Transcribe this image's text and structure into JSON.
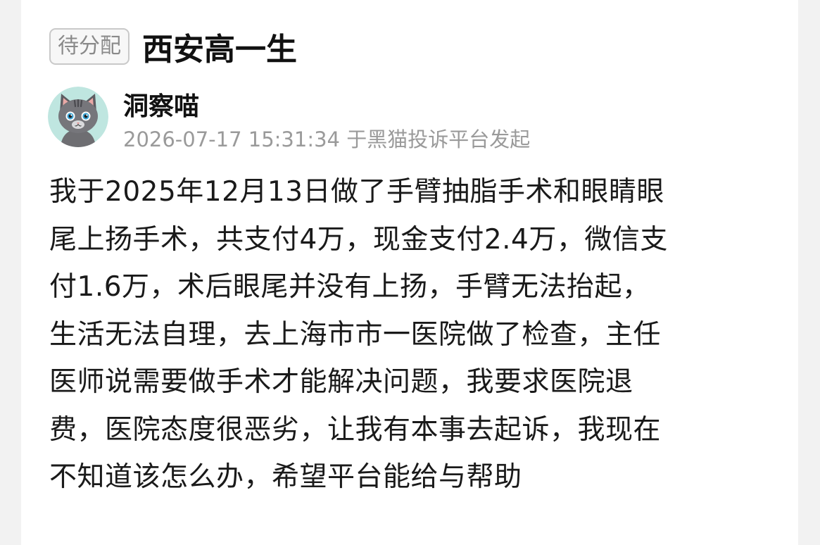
{
  "header": {
    "status_badge": "待分配",
    "title": "西安高一生"
  },
  "author": {
    "name": "洞察喵",
    "avatar_icon": "cat-avatar-icon",
    "meta": "2026-07-17 15:31:34 于黑猫投诉平台发起"
  },
  "post": {
    "lines": [
      "我于2025年12月13日做了手臂抽脂手术和眼睛眼",
      "尾上扬手术，共支付4万，现金支付2.4万，微信支",
      "付1.6万，术后眼尾并没有上扬，手臂无法抬起，",
      "生活无法自理，去上海市市一医院做了检查，主任",
      "医师说需要做手术才能解决问题，我要求医院退",
      "费，医院态度很恶劣，让我有本事去起诉，我现在",
      "不知道该怎么办，希望平台能给与帮助"
    ]
  },
  "colors": {
    "background": "#f2f2f2",
    "card": "#ffffff",
    "badge_border": "#c9c9c9",
    "badge_text": "#8a8a8a",
    "meta_text": "#9a9a9a",
    "body_text": "#1a1a1a",
    "avatar_bg": "#bfe6e0"
  }
}
